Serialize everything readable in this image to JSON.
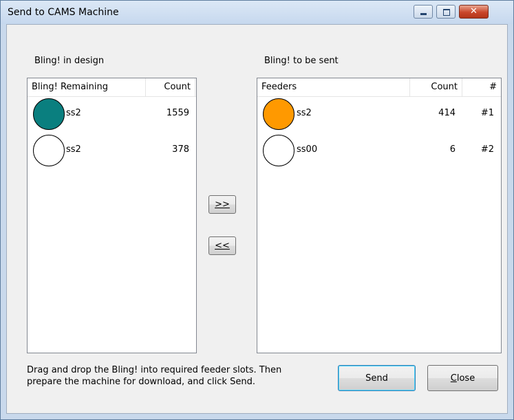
{
  "window": {
    "title": "Send to CAMS Machine"
  },
  "left_panel": {
    "label": "Bling! in design",
    "columns": [
      "Bling! Remaining",
      "Count"
    ],
    "rows": [
      {
        "color": "#0a7f7f",
        "name": "ss2",
        "count": "1559"
      },
      {
        "color": "#ffffff",
        "name": "ss2",
        "count": "378"
      }
    ]
  },
  "right_panel": {
    "label": "Bling! to be sent",
    "columns": [
      "Feeders",
      "Count",
      "#"
    ],
    "rows": [
      {
        "color": "#ff9900",
        "name": "ss2",
        "count": "414",
        "slot": "#1"
      },
      {
        "color": "#ffffff",
        "name": "ss00",
        "count": "6",
        "slot": "#2"
      }
    ]
  },
  "buttons": {
    "move_right": ">>",
    "move_left": "<<",
    "send": "Send",
    "close": "Close"
  },
  "hint": {
    "line1": "Drag and drop the Bling! into required feeder slots. Then",
    "line2": "prepare the machine for download, and click Send."
  }
}
